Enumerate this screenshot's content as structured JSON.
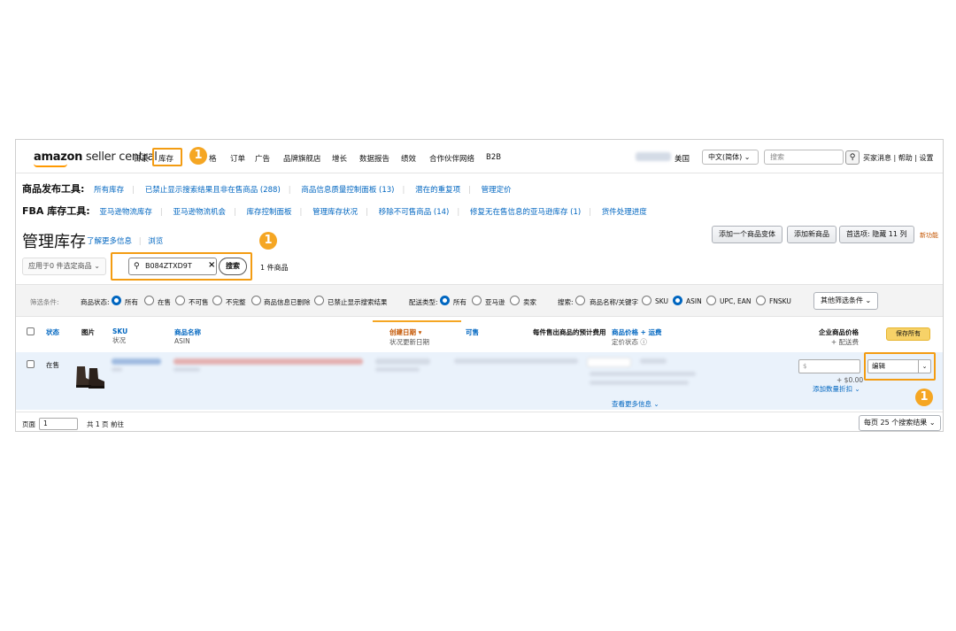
{
  "nav": {
    "logo_bold": "amazon",
    "logo_rest": " seller central",
    "items": [
      "目录",
      "库存",
      "格",
      "订单",
      "广告",
      "品牌旗舰店",
      "增长",
      "数据报告",
      "绩效",
      "合作伙伴网络",
      "B2B"
    ],
    "country": "美国",
    "language": "中文(简体)",
    "search_placeholder": "搜索",
    "right_links": "买家消息 | 帮助 | 设置"
  },
  "badges": {
    "b1": "1",
    "b2": "1",
    "b3": "1"
  },
  "publish_tools": {
    "title": "商品发布工具:",
    "links": [
      "所有库存",
      "已禁止显示搜索结果且非在售商品 (288)",
      "商品信息质量控制面板 (13)",
      "潜在的重复项",
      "管理定价"
    ]
  },
  "fba_tools": {
    "title": "FBA 库存工具:",
    "links": [
      "亚马逊物流库存",
      "亚马逊物流机会",
      "库存控制面板",
      "管理库存状况",
      "移除不可售商品 (14)",
      "修复无在售信息的亚马逊库存 (1)",
      "货件处理进度"
    ]
  },
  "page": {
    "title": "管理库存",
    "learn_more": "了解更多信息",
    "browse": "浏览",
    "add_variant": "添加一个商品变体",
    "add_product": "添加新商品",
    "preferences": "首选项: 隐藏 11 列",
    "new_feature": "新功能"
  },
  "search": {
    "apply_label": "应用于0 件选定商品",
    "query": "B084ZTXD9T",
    "button": "搜索",
    "result_count": "1 件商品"
  },
  "filters": {
    "label": "筛选条件:",
    "status_label": "商品状态:",
    "status_options": [
      "所有",
      "在售",
      "不可售",
      "不完整",
      "商品信息已删除",
      "已禁止显示搜索结果"
    ],
    "fulfillment_label": "配送类型:",
    "fulfillment_options": [
      "所有",
      "亚马逊",
      "卖家"
    ],
    "search_label": "搜索:",
    "search_options": [
      "商品名称/关键字",
      "SKU",
      "ASIN",
      "UPC, EAN",
      "FNSKU"
    ],
    "more": "其他筛选条件"
  },
  "columns": {
    "status": "状态",
    "image": "图片",
    "sku": "SKU",
    "sku_sub": "状况",
    "name": "商品名称",
    "name_sub": "ASIN",
    "created": "创建日期",
    "created_sub": "状况更新日期",
    "available": "可售",
    "fee": "每件售出商品的预计费用",
    "price": "商品价格",
    "price_plus": "+ 运费",
    "price_sub": "定价状态",
    "business_price": "企业商品价格",
    "business_sub": "+ 配送费",
    "save_all": "保存所有"
  },
  "row": {
    "status": "在售",
    "price_placeholder": "$",
    "shipping": "+ $0.00",
    "add_discount": "添加数量折扣",
    "action": "编辑",
    "more_info": "查看更多信息"
  },
  "footer": {
    "page_label": "页面",
    "page_value": "1",
    "total_pages": "共 1 页",
    "go": "前往",
    "per_page": "每页 25 个搜索结果"
  },
  "colors": {
    "accent": "#f5a623",
    "link": "#0066c0"
  }
}
